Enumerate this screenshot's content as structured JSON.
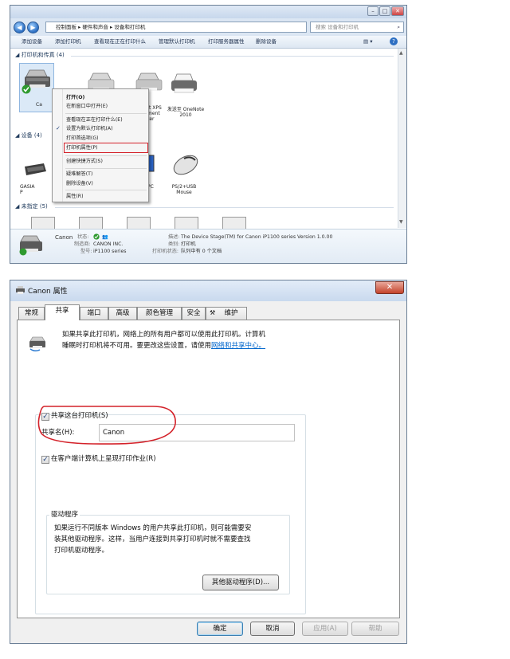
{
  "devices_window": {
    "address_path": [
      "控制面板",
      "硬件和声音",
      "设备和打印机"
    ],
    "search_placeholder": "搜索 设备和打印机",
    "toolbar": [
      "添加设备",
      "添加打印机",
      "查看现在正在打印什么",
      "管理默认打印机",
      "打印服务器属性",
      "删除设备"
    ],
    "group_printers": "打印机和传真 (4)",
    "group_devices": "设备 (4)",
    "group_unspecified": "未指定 (5)",
    "printers": [
      {
        "label": "Ca"
      },
      {
        "label": ""
      },
      {
        "label": "ft XPS\nment\nter"
      },
      {
        "label": "发送至 OneNote\n2010"
      }
    ],
    "devices": [
      {
        "label": "GASIA\nP"
      },
      {
        "label": "PC"
      },
      {
        "label": "PS/2+USB\nMouse"
      }
    ],
    "context_menu": [
      {
        "label": "打开(O)",
        "bold": true
      },
      {
        "label": "在新窗口中打开(E)"
      },
      {
        "label": "查看现在正在打印什么(E)"
      },
      {
        "label": "设置为默认打印机(A)",
        "checked": true
      },
      {
        "label": "打印首选项(G)"
      },
      {
        "label": "打印机属性(P)",
        "highlighted": true
      },
      {
        "label": "创建快捷方式(S)"
      },
      {
        "label": "疑难解答(T)"
      },
      {
        "label": "删除设备(V)"
      },
      {
        "label": "属性(R)"
      }
    ],
    "details": {
      "name": "Canon",
      "status_key": "状态:",
      "manufacturer_key": "制造商:",
      "manufacturer": "CANON INC.",
      "model_key": "型号:",
      "model": "iP1100 series",
      "description_key": "描述:",
      "description": "The Device Stage(TM) for Canon iP1100 series Version 1.0.00",
      "category_key": "类别:",
      "category": "打印机",
      "printer_status_key": "打印机状态:",
      "printer_status": "队列中有 0 个文档"
    }
  },
  "properties_dialog": {
    "title": "Canon 属性",
    "close": "✕",
    "tabs": [
      "常规",
      "共享",
      "端口",
      "高级",
      "颜色管理",
      "安全",
      "维护"
    ],
    "active_tab": "共享",
    "info_line1": "如果共享此打印机，网络上的所有用户都可以使用此打印机。计算机",
    "info_line2_a": "睡眠时打印机将不可用。要更改这些设置，请使用",
    "info_link": "网络和共享中心。",
    "share_checkbox_label": "共享这台打印机(S)",
    "share_checked": true,
    "share_name_label": "共享名(H):",
    "share_name_value": "Canon",
    "render_jobs_label": "在客户端计算机上呈现打印作业(R)",
    "render_jobs_checked": true,
    "drivers_group_title": "驱动程序",
    "drivers_text": [
      "如果运行不同版本 Windows 的用户共享此打印机，则可能需要安",
      "装其他驱动程序。这样，当用户连接到共享打印机时就不需要查找",
      "打印机驱动程序。"
    ],
    "other_drivers_button": "其他驱动程序(D)...",
    "ok": "确定",
    "cancel": "取消",
    "apply": "应用(A)",
    "help": "帮助"
  }
}
